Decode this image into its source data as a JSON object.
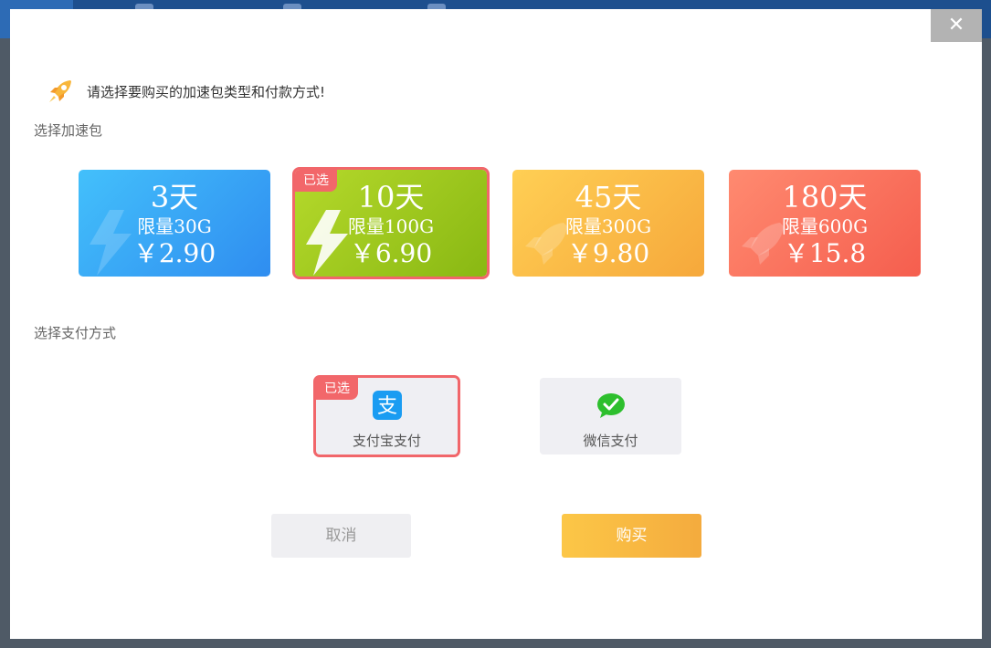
{
  "dialog": {
    "close_label": "✕",
    "header_text": "请选择要购买的加速包类型和付款方式!",
    "section_package": "选择加速包",
    "section_payment": "选择支付方式",
    "selected_badge": "已选"
  },
  "packages": [
    {
      "days": "3天",
      "limit": "限量30G",
      "price": "￥2.90",
      "color": "#3aa6f7",
      "icon": "lightning-icon",
      "selected": false
    },
    {
      "days": "10天",
      "limit": "限量100G",
      "price": "￥6.90",
      "color": "#9fc91e",
      "icon": "lightning-icon",
      "selected": true
    },
    {
      "days": "45天",
      "limit": "限量300G",
      "price": "￥9.80",
      "color": "#fbbb47",
      "icon": "rocket-icon",
      "selected": false
    },
    {
      "days": "180天",
      "limit": "限量600G",
      "price": "￥15.8",
      "color": "#f87060",
      "icon": "rocket-icon",
      "selected": false
    }
  ],
  "payments": [
    {
      "label": "支付宝支付",
      "icon": "alipay-icon",
      "color": "#1a9cf2",
      "selected": true
    },
    {
      "label": "微信支付",
      "icon": "wechat-icon",
      "color": "#2dbf2d",
      "selected": false
    }
  ],
  "buttons": {
    "cancel": "取消",
    "buy": "购买"
  },
  "colors": {
    "selected_outline": "#f1666a",
    "buy_button": "#f7b742"
  }
}
